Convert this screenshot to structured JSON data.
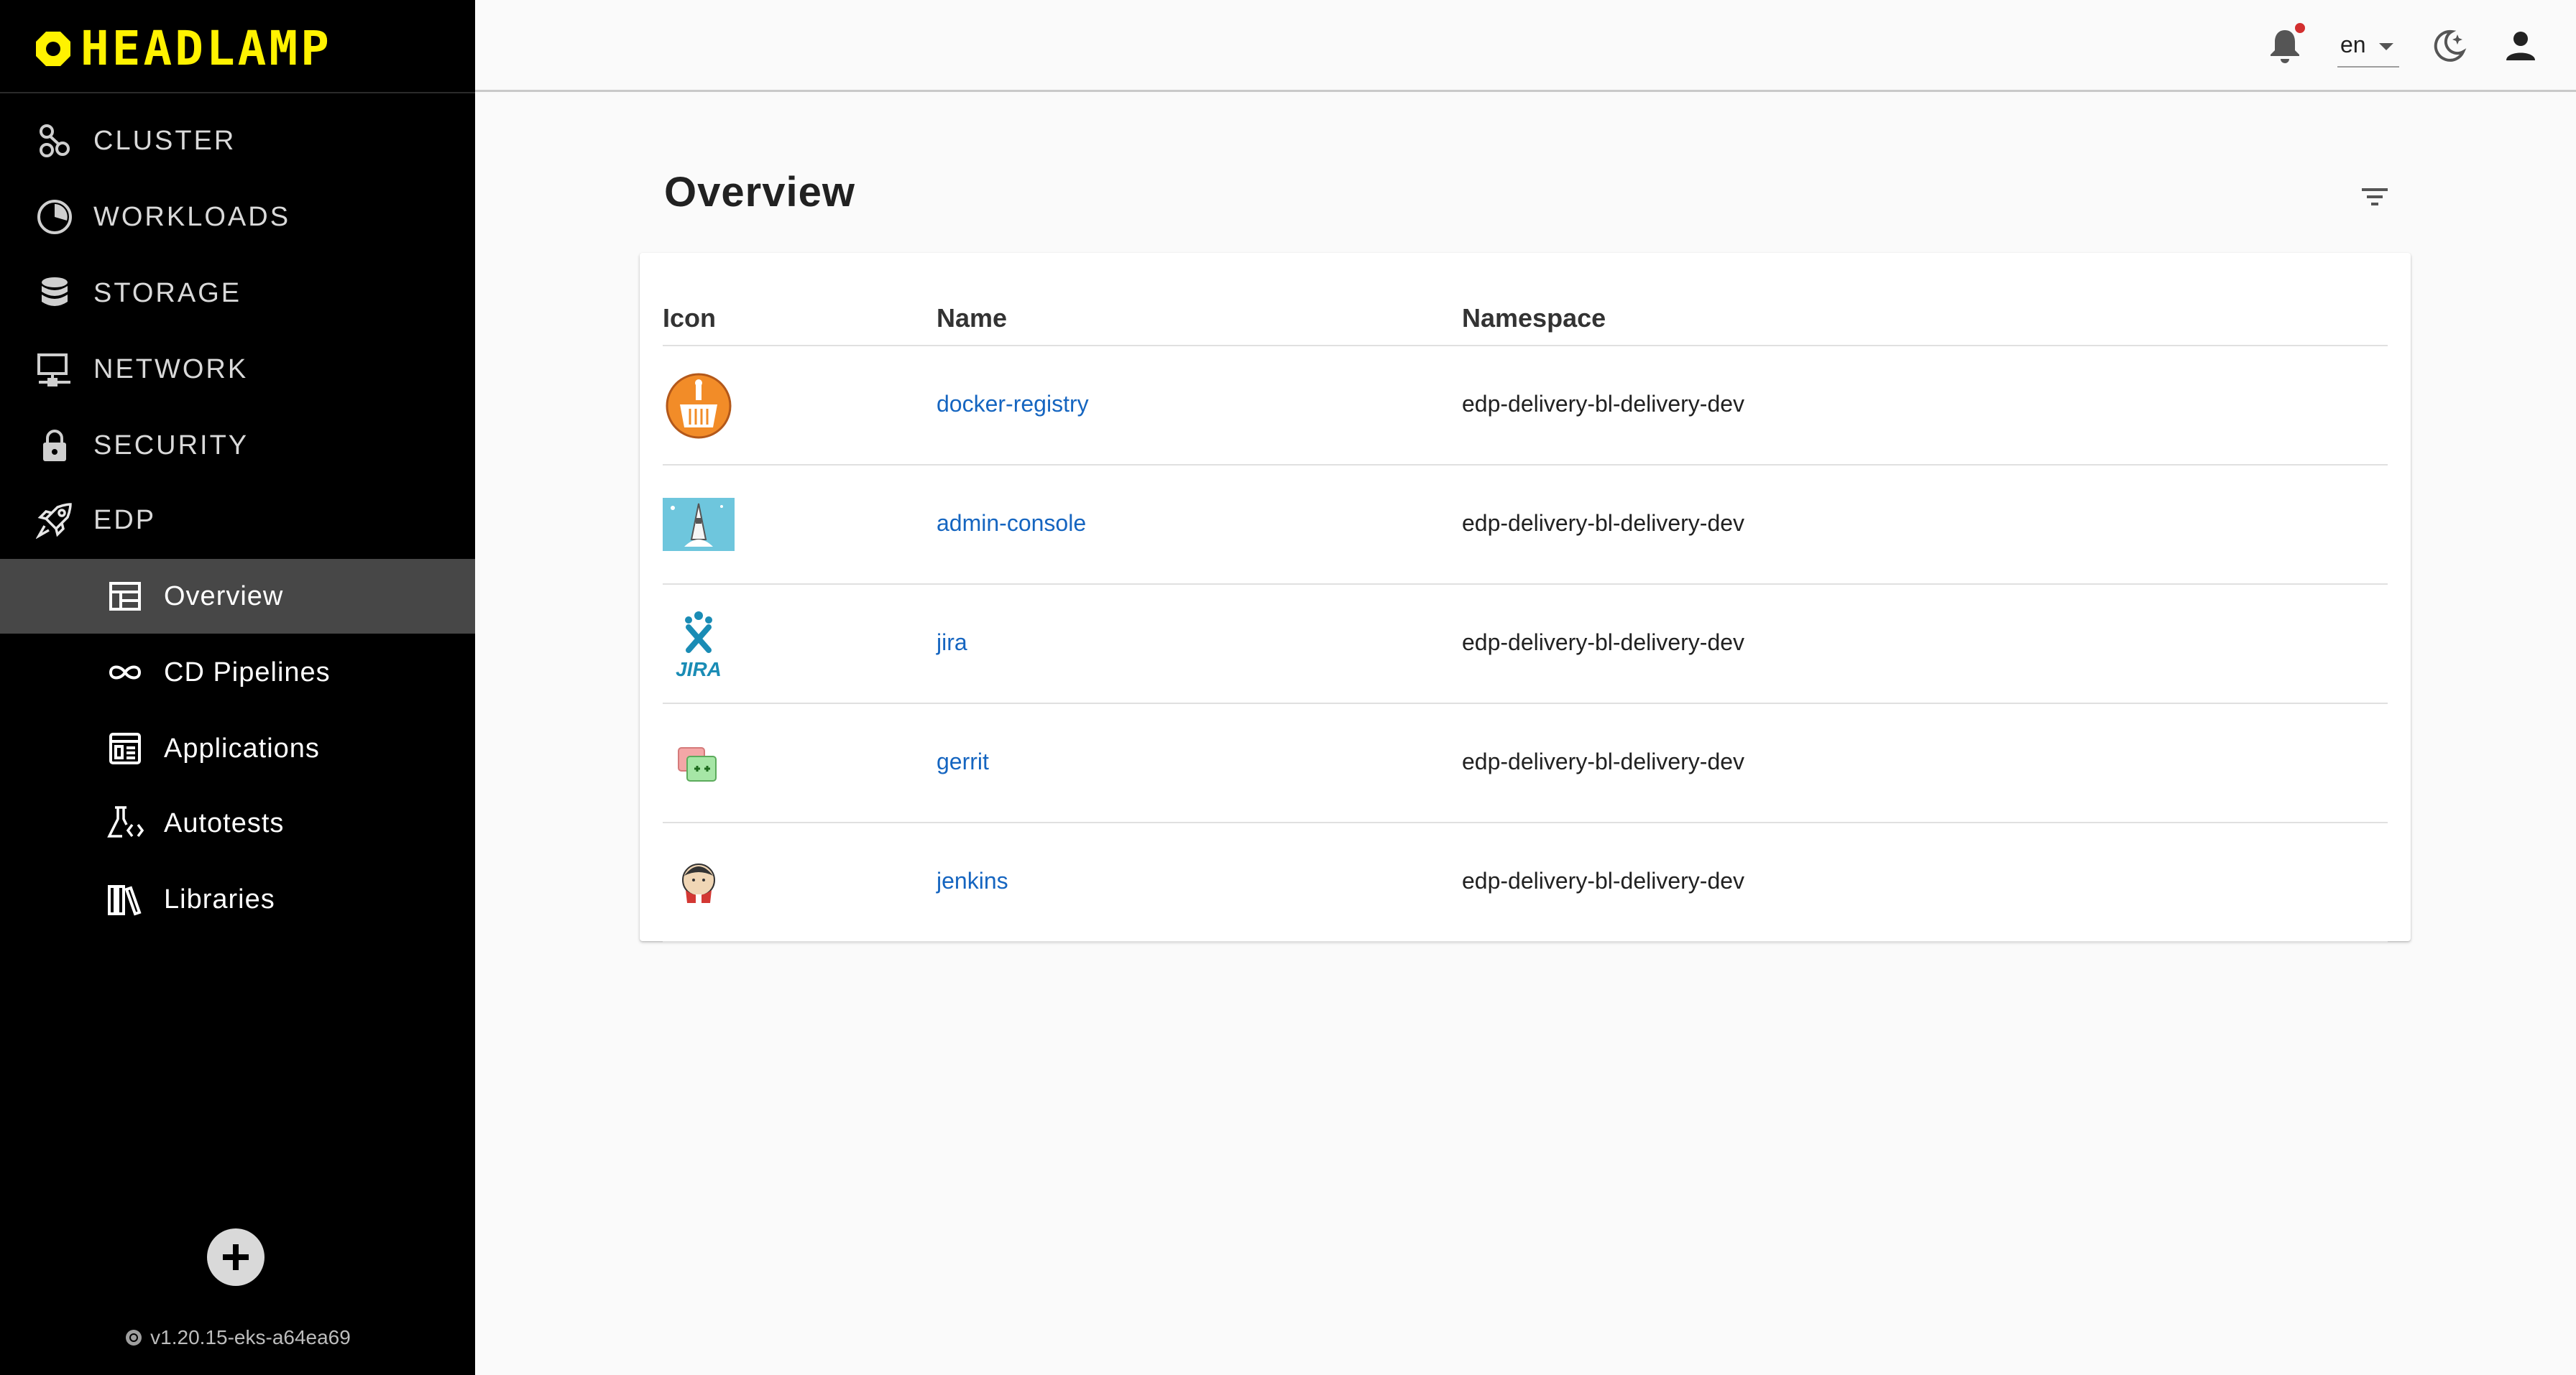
{
  "brand": {
    "name": "HEADLAMP",
    "logo_color": "#fff200"
  },
  "sidebar": {
    "items": [
      {
        "label": "CLUSTER",
        "icon": "cluster-icon"
      },
      {
        "label": "WORKLOADS",
        "icon": "workloads-icon"
      },
      {
        "label": "STORAGE",
        "icon": "storage-icon"
      },
      {
        "label": "NETWORK",
        "icon": "network-icon"
      },
      {
        "label": "SECURITY",
        "icon": "lock-icon"
      },
      {
        "label": "EDP",
        "icon": "rocket-icon"
      }
    ],
    "sub_items": [
      {
        "label": "Overview",
        "icon": "overview-icon",
        "active": true
      },
      {
        "label": "CD Pipelines",
        "icon": "infinity-icon"
      },
      {
        "label": "Applications",
        "icon": "applications-icon"
      },
      {
        "label": "Autotests",
        "icon": "autotests-icon"
      },
      {
        "label": "Libraries",
        "icon": "libraries-icon"
      }
    ],
    "version": "v1.20.15-eks-a64ea69",
    "active_bg": "#474747"
  },
  "appbar": {
    "language": "en",
    "notification_dot_color": "#d32f2f"
  },
  "main": {
    "title": "Overview",
    "table": {
      "headers": [
        "Icon",
        "Name",
        "Namespace"
      ],
      "rows": [
        {
          "icon": "docker-registry-icon",
          "name": "docker-registry",
          "namespace": "edp-delivery-bl-delivery-dev"
        },
        {
          "icon": "admin-console-icon",
          "name": "admin-console",
          "namespace": "edp-delivery-bl-delivery-dev"
        },
        {
          "icon": "jira-icon",
          "name": "jira",
          "namespace": "edp-delivery-bl-delivery-dev",
          "icon_text": "JIRA"
        },
        {
          "icon": "gerrit-icon",
          "name": "gerrit",
          "namespace": "edp-delivery-bl-delivery-dev"
        },
        {
          "icon": "jenkins-icon",
          "name": "jenkins",
          "namespace": "edp-delivery-bl-delivery-dev"
        }
      ]
    },
    "link_color": "#1565c0"
  }
}
